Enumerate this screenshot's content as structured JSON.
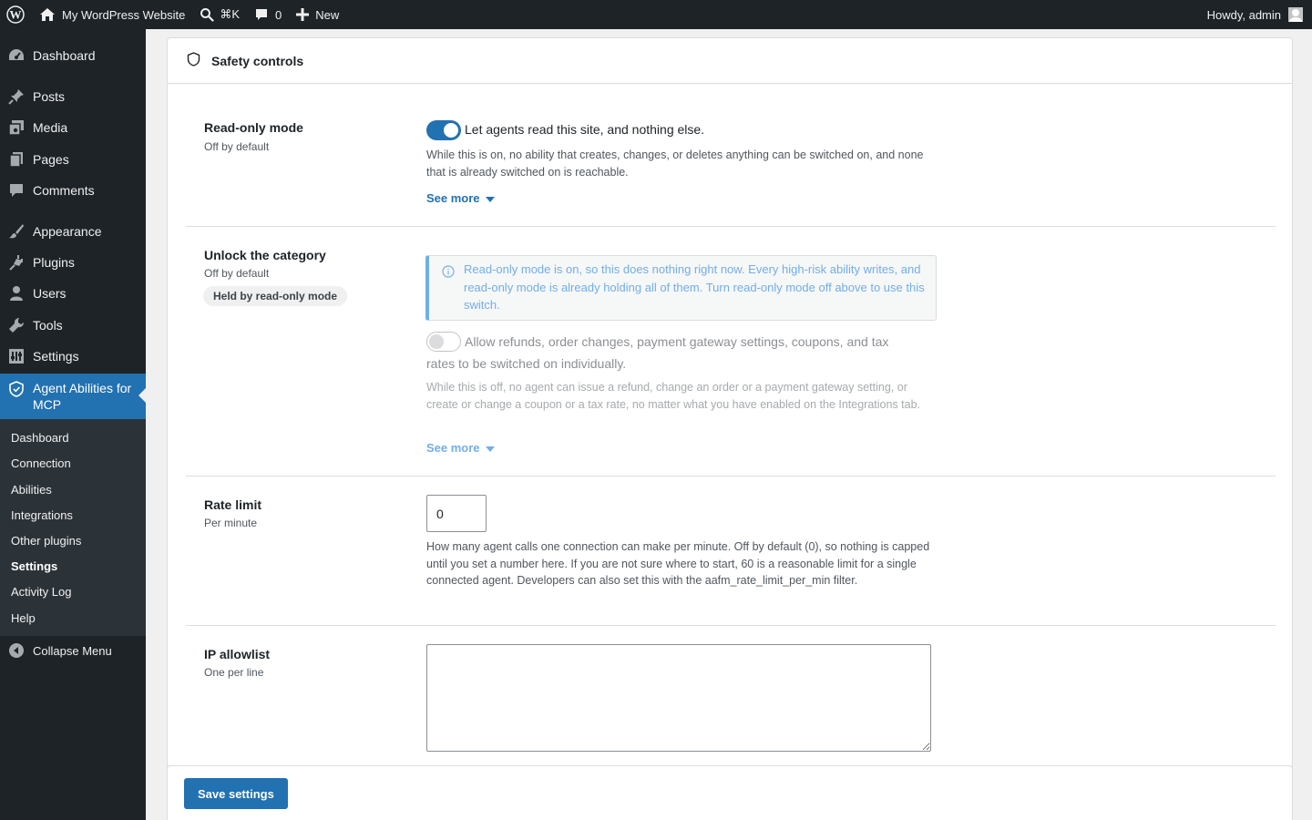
{
  "adminbar": {
    "site_name": "My WordPress Website",
    "search_shortcut": "⌘K",
    "comments_count": "0",
    "new_label": "New",
    "greeting": "Howdy, admin"
  },
  "sidebar": {
    "items": [
      {
        "label": "Dashboard",
        "icon": "dashboard-icon"
      },
      {
        "label": "Posts",
        "icon": "pin-icon"
      },
      {
        "label": "Media",
        "icon": "media-icon"
      },
      {
        "label": "Pages",
        "icon": "pages-icon"
      },
      {
        "label": "Comments",
        "icon": "comment-icon"
      },
      {
        "label": "Appearance",
        "icon": "brush-icon"
      },
      {
        "label": "Plugins",
        "icon": "plugin-icon"
      },
      {
        "label": "Users",
        "icon": "user-icon"
      },
      {
        "label": "Tools",
        "icon": "wrench-icon"
      },
      {
        "label": "Settings",
        "icon": "settings-icon"
      },
      {
        "label": "Agent Abilities for MCP",
        "icon": "shield-check-icon"
      }
    ],
    "submenu": [
      "Dashboard",
      "Connection",
      "Abilities",
      "Integrations",
      "Other plugins",
      "Settings",
      "Activity Log",
      "Help"
    ],
    "submenu_current": "Settings",
    "collapse_label": "Collapse Menu",
    "accent": "#2271b1"
  },
  "panel": {
    "title": "Safety controls",
    "read_only": {
      "label": "Read-only mode",
      "sublabel": "Off by default",
      "toggle_on": true,
      "toggle_text": "Let agents read this site, and nothing else.",
      "description": "While this is on, no ability that creates, changes, or deletes anything can be switched on, and none that is already switched on is reachable.",
      "see_more": "See more"
    },
    "unlock": {
      "label": "Unlock the category",
      "sublabel": "Off by default",
      "badge": "Held by read-only mode",
      "notice": "Read-only mode is on, so this does nothing right now. Every high-risk ability writes, and read-only mode is already holding all of them. Turn read-only mode off above to use this switch.",
      "toggle_on": false,
      "toggle_text": "Allow refunds, order changes, payment gateway settings, coupons, and tax rates to be switched on individually.",
      "description": "While this is off, no agent can issue a refund, change an order or a payment gateway setting, or create or change a coupon or a tax rate, no matter what you have enabled on the Integrations tab.",
      "see_more": "See more"
    },
    "rate_limit": {
      "label": "Rate limit",
      "sublabel": "Per minute",
      "value": "0",
      "description": "How many agent calls one connection can make per minute. Off by default (0), so nothing is capped until you set a number here. If you are not sure where to start, 60 is a reasonable limit for a single connected agent. Developers can also set this with the aafm_rate_limit_per_min filter."
    },
    "ip_allowlist": {
      "label": "IP allowlist",
      "sublabel": "One per line",
      "value": ""
    }
  },
  "footer": {
    "save_label": "Save settings"
  }
}
